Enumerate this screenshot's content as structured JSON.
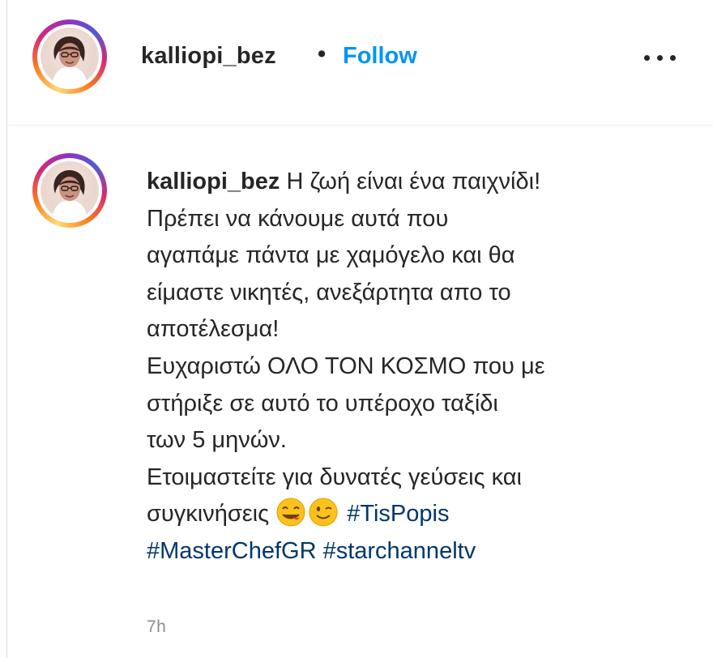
{
  "post": {
    "author": "kalliopi_bez",
    "separator": "•",
    "follow_label": "Follow",
    "more_icon": "more-options-icon"
  },
  "caption": {
    "author": "kalliopi_bez",
    "lines": [
      "Η ζωή είναι ένα παιχνίδι!",
      "Πρέπει να κάνουμε αυτά που",
      "αγαπάμε πάντα με χαμόγελο και θα",
      "είμαστε νικητές, ανεξάρτητα απο το",
      "αποτέλεσμα!",
      "Ευχαριστώ ΟΛΟ ΤΟΝ ΚΟΣΜΟ που με",
      "στήριξε σε αυτό το υπέροχο ταξίδι",
      "των 5 μηνών.",
      "Ετοιμαστείτε για δυνατές γεύσεις και",
      "συγκινήσεις"
    ],
    "emojis": [
      "face-savoring-food-emoji",
      "winking-face-emoji"
    ],
    "hashtags": [
      "#TisPopis",
      "#MasterChefGR",
      "#starchanneltv"
    ]
  },
  "timestamp": "7h",
  "colors": {
    "link_blue": "#0095f6",
    "hashtag_blue": "#00376b",
    "text": "#262626",
    "muted": "#8e8e8e"
  }
}
